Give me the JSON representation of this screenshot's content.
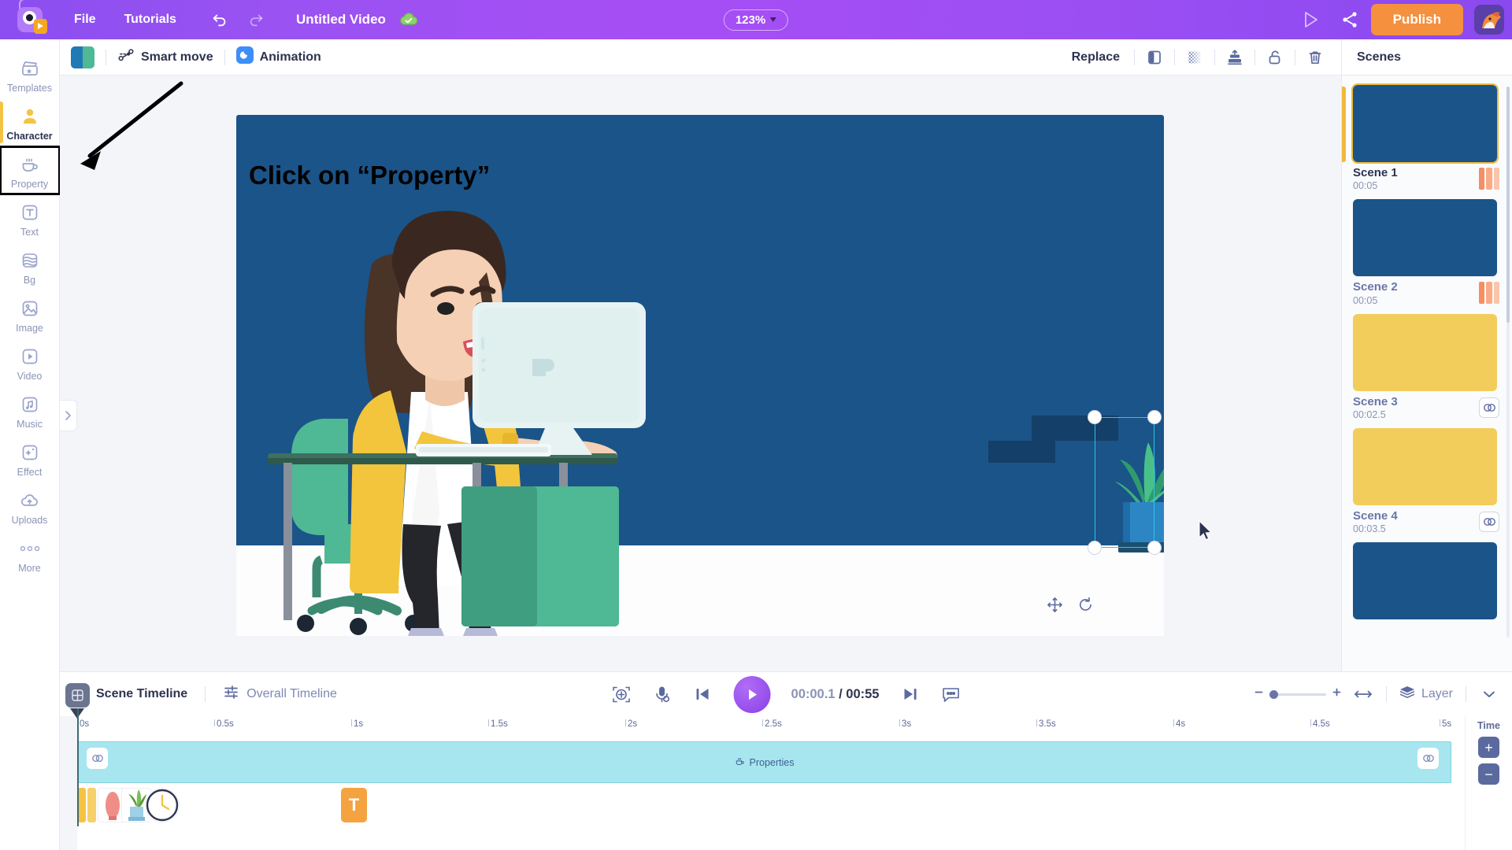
{
  "topbar": {
    "logo_name": "animaker-logo",
    "menus": [
      {
        "label": "File",
        "name": "menu-file"
      },
      {
        "label": "Tutorials",
        "name": "menu-tutorials"
      }
    ],
    "undo_icon": "undo-icon",
    "redo_icon": "redo-icon",
    "doc_title": "Untitled Video",
    "saved_icon": "cloud-saved-icon",
    "zoom_level": "123%",
    "preview_icon": "play-preview-icon",
    "share_icon": "share-icon",
    "publish_label": "Publish",
    "avatar_name": "user-avatar"
  },
  "sidebar": {
    "items": [
      {
        "label": "Templates",
        "icon": "clapperboard-icon",
        "state": "normal"
      },
      {
        "label": "Character",
        "icon": "person-icon",
        "state": "active"
      },
      {
        "label": "Property",
        "icon": "cup-icon",
        "state": "highlight"
      },
      {
        "label": "Text",
        "icon": "text-t-icon",
        "state": "normal"
      },
      {
        "label": "Bg",
        "icon": "layers-wave-icon",
        "state": "normal"
      },
      {
        "label": "Image",
        "icon": "image-icon",
        "state": "normal"
      },
      {
        "label": "Video",
        "icon": "video-play-icon",
        "state": "normal"
      },
      {
        "label": "Music",
        "icon": "music-note-icon",
        "state": "normal"
      },
      {
        "label": "Effect",
        "icon": "sparkle-icon",
        "state": "normal"
      },
      {
        "label": "Uploads",
        "icon": "cloud-upload-icon",
        "state": "normal"
      },
      {
        "label": "More",
        "icon": "three-dots-icon",
        "state": "normal"
      }
    ],
    "expand_icon": "chevron-right-icon"
  },
  "objbar": {
    "swatch_colors": [
      "#2179b5",
      "#4fb894"
    ],
    "smart_move": "Smart move",
    "smart_move_icon": "smart-move-icon",
    "animation": "Animation",
    "animation_icon": "animation-moon-icon",
    "replace": "Replace",
    "icons": [
      {
        "name": "flip-horizontal-icon"
      },
      {
        "name": "transparency-icon"
      },
      {
        "name": "align-layer-icon"
      },
      {
        "name": "unlock-icon"
      },
      {
        "name": "delete-trash-icon"
      }
    ]
  },
  "canvas": {
    "annotation": "Click on “Property”",
    "annotation_arrow": "arrow-pointing-to-property",
    "scene_bg_color": "#1b5488",
    "selected_object": "potted-plant",
    "move_icon": "move-icon",
    "rotate_icon": "rotate-icon",
    "cursor": "mouse-pointer"
  },
  "scenes": {
    "title": "Scenes",
    "list": [
      {
        "name": "Scene 1",
        "duration": "00:05",
        "color": "#1b5488",
        "selected": true,
        "right_icon": "transition-bars"
      },
      {
        "name": "Scene 2",
        "duration": "00:05",
        "color": "#1b5488",
        "selected": false,
        "right_icon": "transition-bars"
      },
      {
        "name": "Scene 3",
        "duration": "00:02.5",
        "color": "#f3cd5b",
        "selected": false,
        "right_icon": "transition-link"
      },
      {
        "name": "Scene 4",
        "duration": "00:03.5",
        "color": "#f3cd5b",
        "selected": false,
        "right_icon": "transition-link"
      },
      {
        "name": "",
        "duration": "",
        "color": "#1b5488",
        "selected": false,
        "right_icon": ""
      }
    ]
  },
  "timeline": {
    "scene_tab": "Scene Timeline",
    "scene_tab_icon": "scene-timeline-icon",
    "overall_tab": "Overall Timeline",
    "overall_tab_icon": "overall-timeline-icon",
    "controls": [
      {
        "name": "add-focus-icon"
      },
      {
        "name": "microphone-icon"
      },
      {
        "name": "skip-previous-icon"
      }
    ],
    "play_icon": "play-button",
    "current_time": "00:00.1",
    "time_separator": "/",
    "total_time": "00:55",
    "next_icon": "skip-next-icon",
    "caption_icon": "caption-icon",
    "zoom_out_icon": "minus-icon",
    "zoom_in_icon": "plus-icon",
    "fit_icon": "fit-width-icon",
    "layer_label": "Layer",
    "layer_icon": "layers-stack-icon",
    "collapse_icon": "chevron-down-icon",
    "ruler_ticks": [
      "0s",
      "0.5s",
      "1s",
      "1.5s",
      "2s",
      "2.5s",
      "3s",
      "3.5s",
      "4s",
      "4.5s",
      "5s"
    ],
    "clip_label": "Properties",
    "clip_icon": "cup-icon",
    "clip_link_icon": "transition-link-icon",
    "text_element_label": "T",
    "time_column_label": "Time",
    "time_plus": "+",
    "time_minus": "−"
  }
}
